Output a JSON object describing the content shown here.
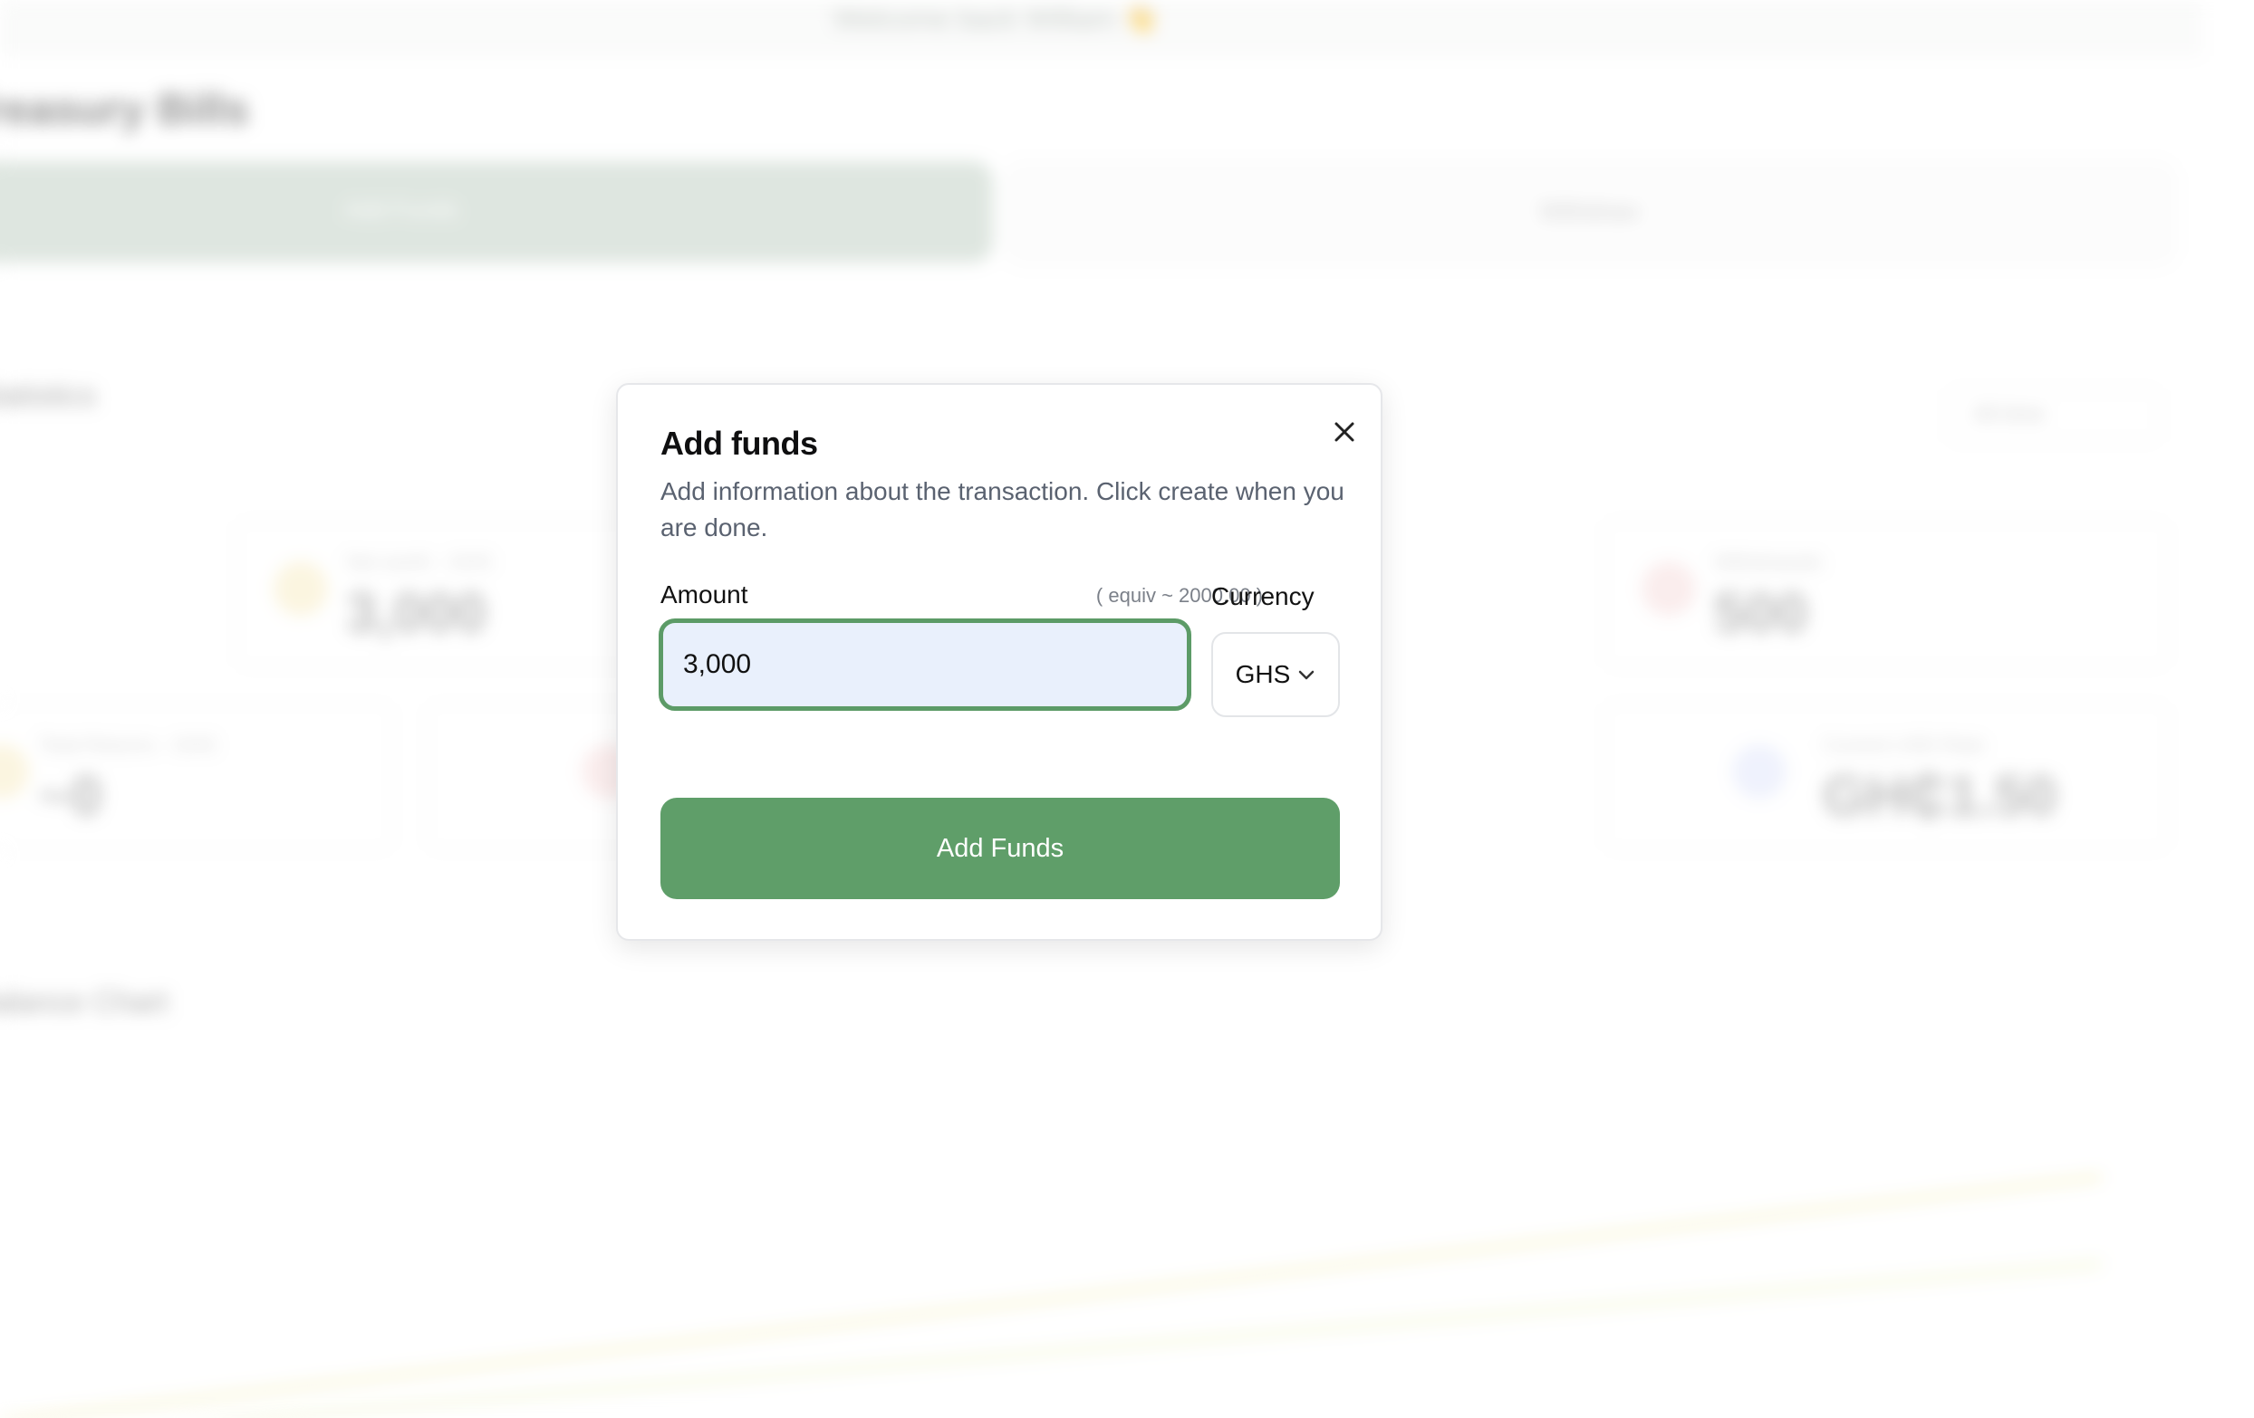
{
  "background": {
    "welcome_text": "Welcome back William",
    "welcome_emoji": "👋",
    "page_title": "Treasury Bills",
    "tabs": [
      {
        "label": "Add Funds"
      },
      {
        "label": "Withdraw"
      }
    ],
    "statistics_label": "Statistics",
    "filter_select": "All time",
    "stats": [
      {
        "label": "Net worth - GHS",
        "value": "3,000",
        "icon": "trend-icon",
        "color": "#f3d57a"
      },
      {
        "label": "Withdrawals",
        "value": "500",
        "icon": "withdraw-icon",
        "color": "#f0a6a6"
      },
      {
        "label": "Total Returns - GHS",
        "value": "~0",
        "icon": "returns-icon",
        "color": "#f3d57a"
      },
      {
        "label": "Current USD Rate",
        "value": "GH₵1.50",
        "icon": "rate-icon",
        "color": "#aab7f0"
      }
    ],
    "chart_label": "Balance Chart"
  },
  "modal": {
    "title": "Add funds",
    "description": "Add information about the transaction. Click create when you are done.",
    "close_icon": "close-icon",
    "amount_label": "Amount",
    "equiv_text": "( equiv ~ 2000.00 )",
    "amount_value": "3,000",
    "currency_label": "Currency",
    "currency_value": "GHS",
    "submit_label": "Add Funds",
    "colors": {
      "accent": "#5f9e69",
      "input_focus_border": "#5c9b67",
      "input_bg": "#e9f0fc"
    }
  }
}
